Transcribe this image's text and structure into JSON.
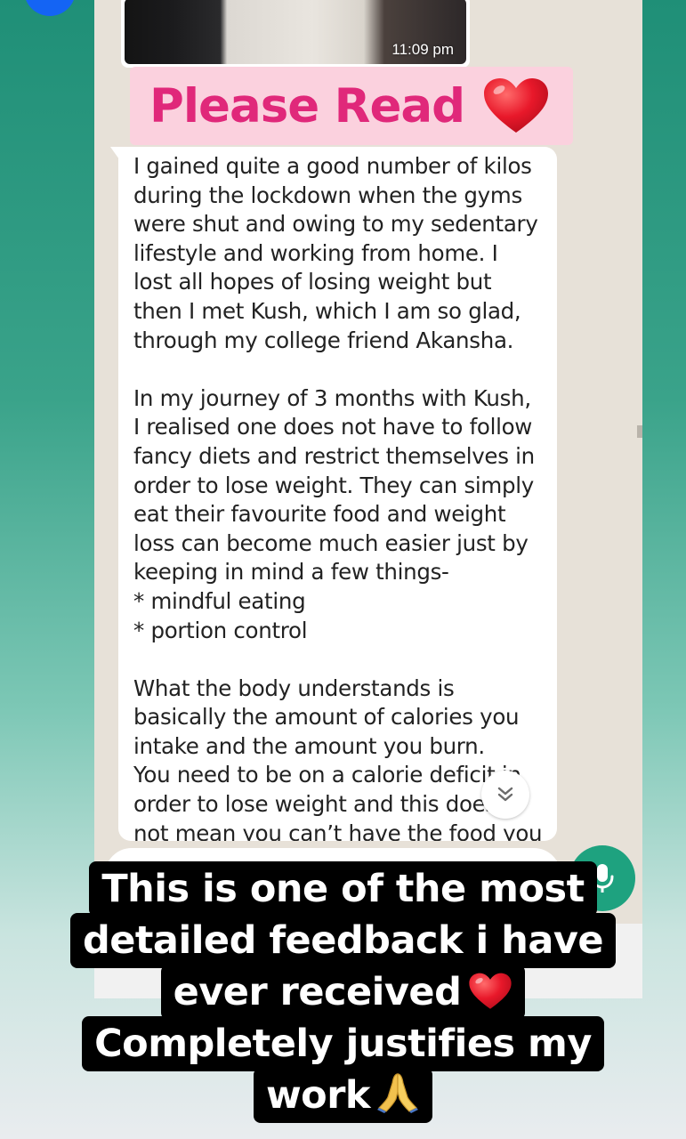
{
  "chat": {
    "image_message": {
      "time": "11:09 pm"
    },
    "sticker": {
      "text": "Please Read",
      "emoji_icon": "red-heart-icon"
    },
    "message_lines": [
      "I gained quite a good number of kilos",
      "during the lockdown when the gyms",
      "were shut and owing to my sedentary",
      "lifestyle and working from home. I",
      "lost all hopes of losing weight but",
      "then I met Kush, which I am so glad,",
      "through my college friend Akansha.",
      "",
      "In my journey of 3 months with Kush,",
      "I realised one does not have to follow",
      "fancy diets and restrict themselves in",
      "order to lose weight. They can simply",
      "eat their favourite food and weight",
      "loss can become much easier just by",
      "keeping in mind a few things-",
      "* mindful eating",
      "* portion control",
      "",
      "What the body understands is",
      "basically the amount of calories you",
      "intake and the amount you burn.",
      "You need to be on a calorie deficit in",
      "order to lose weight and this does",
      "not mean you can’t have the food you"
    ],
    "scroll_down_icon": "double-chevron-down-icon",
    "mic_icon": "microphone-icon"
  },
  "caption": {
    "lines": [
      "This is one of the most",
      "detailed feedback i have",
      "ever received",
      "Completely justifies my",
      "work"
    ],
    "line3_emoji": "red-heart-icon",
    "line5_emoji": "folded-hands-icon"
  },
  "colors": {
    "whatsapp_green": "#1ea27f",
    "sticker_pink": "#e0287a",
    "sticker_bg": "#fbd1de",
    "chat_bg": "#e7e1d8",
    "heart_red": "#e8182a"
  }
}
